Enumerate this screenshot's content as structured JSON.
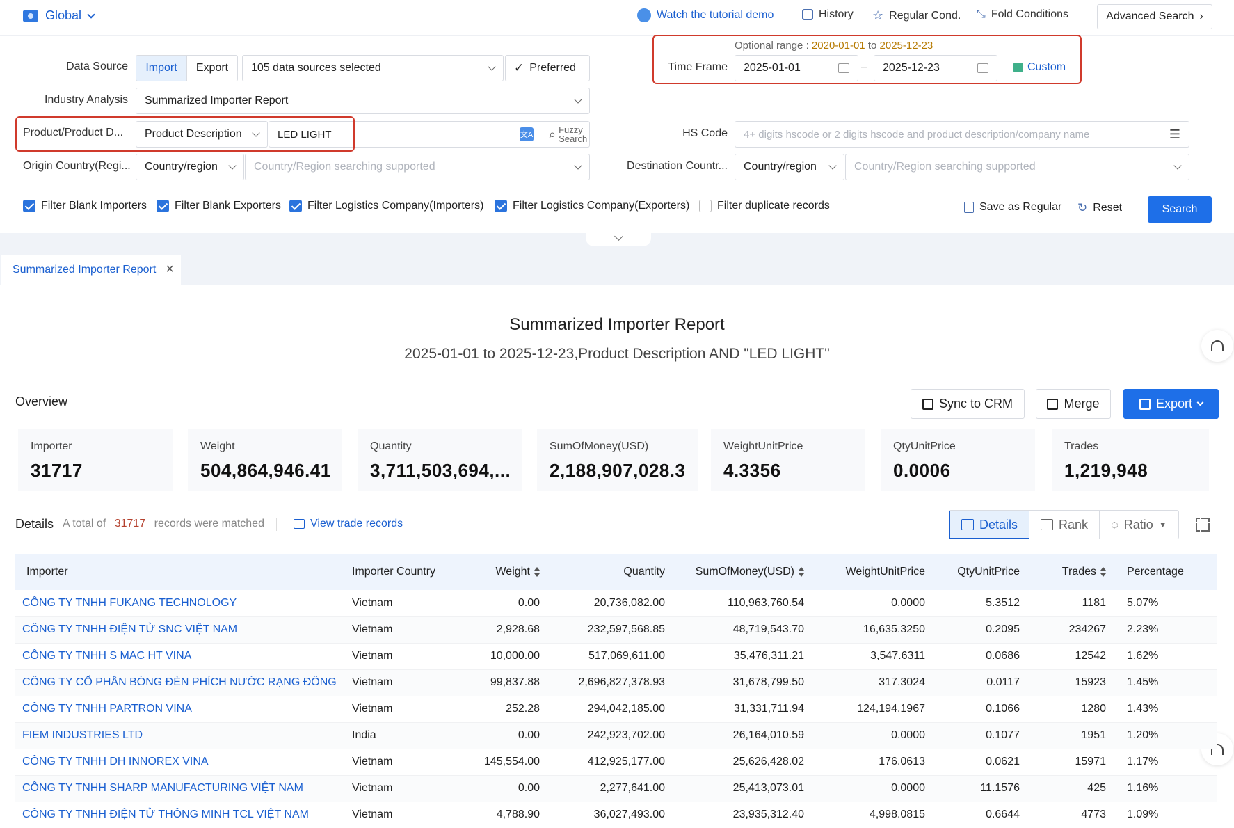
{
  "topbar": {
    "global_label": "Global",
    "tutorial": "Watch the tutorial demo",
    "history": "History",
    "regular_cond": "Regular Cond.",
    "fold_conditions": "Fold Conditions",
    "advanced_search": "Advanced Search"
  },
  "filters": {
    "data_source_label": "Data Source",
    "import_label": "Import",
    "export_label": "Export",
    "sources_selected": "105 data sources selected",
    "preferred": "Preferred",
    "industry_label": "Industry Analysis",
    "industry_value": "Summarized Importer Report",
    "product_label": "Product/Product D...",
    "product_type": "Product Description",
    "product_value": "LED LIGHT",
    "fuzzy_search": "Fuzzy Search",
    "origin_label": "Origin Country(Regi...",
    "origin_type": "Country/region",
    "origin_placeholder": "Country/Region searching supported",
    "optional_range_label": "Optional range :",
    "optional_range_start": "2020-01-01",
    "optional_range_to": "to",
    "optional_range_end": "2025-12-23",
    "timeframe_label": "Time Frame",
    "start_date": "2025-01-01",
    "end_date": "2025-12-23",
    "custom": "Custom",
    "hs_label": "HS Code",
    "hs_placeholder": "4+ digits hscode or 2 digits hscode and product description/company name",
    "dest_label": "Destination Countr...",
    "dest_type": "Country/region",
    "dest_placeholder": "Country/Region searching supported"
  },
  "checks": [
    {
      "label": "Filter Blank Importers",
      "checked": true
    },
    {
      "label": "Filter Blank Exporters",
      "checked": true
    },
    {
      "label": "Filter Logistics Company(Importers)",
      "checked": true
    },
    {
      "label": "Filter Logistics Company(Exporters)",
      "checked": true
    },
    {
      "label": "Filter duplicate records",
      "checked": false
    }
  ],
  "actions": {
    "save_regular": "Save as Regular",
    "reset": "Reset",
    "search": "Search"
  },
  "tab": {
    "label": "Summarized Importer Report"
  },
  "report": {
    "title": "Summarized Importer Report",
    "subtitle": "2025-01-01 to 2025-12-23,Product Description AND \"LED LIGHT\""
  },
  "overview": {
    "title": "Overview",
    "sync": "Sync to CRM",
    "merge": "Merge",
    "export": "Export",
    "stats": [
      {
        "label": "Importer",
        "value": "31717"
      },
      {
        "label": "Weight",
        "value": "504,864,946.41"
      },
      {
        "label": "Quantity",
        "value": "3,711,503,694,..."
      },
      {
        "label": "SumOfMoney(USD)",
        "value": "2,188,907,028.3"
      },
      {
        "label": "WeightUnitPrice",
        "value": "4.3356"
      },
      {
        "label": "QtyUnitPrice",
        "value": "0.0006"
      },
      {
        "label": "Trades",
        "value": "1,219,948"
      }
    ]
  },
  "details": {
    "title": "Details",
    "total_prefix": "A total of",
    "total_count": "31717",
    "total_suffix": "records were matched",
    "view_trade": "View trade records",
    "view_details": "Details",
    "view_rank": "Rank",
    "view_ratio": "Ratio"
  },
  "table": {
    "headers": [
      "Importer",
      "Importer Country",
      "Weight",
      "Quantity",
      "SumOfMoney(USD)",
      "WeightUnitPrice",
      "QtyUnitPrice",
      "Trades",
      "Percentage"
    ],
    "rows": [
      [
        "CÔNG TY TNHH FUKANG TECHNOLOGY",
        "Vietnam",
        "0.00",
        "20,736,082.00",
        "110,963,760.54",
        "0.0000",
        "5.3512",
        "1181",
        "5.07%"
      ],
      [
        "CÔNG TY TNHH ĐIỆN TỬ SNC VIỆT NAM",
        "Vietnam",
        "2,928.68",
        "232,597,568.85",
        "48,719,543.70",
        "16,635.3250",
        "0.2095",
        "234267",
        "2.23%"
      ],
      [
        "CÔNG TY TNHH S MAC HT VINA",
        "Vietnam",
        "10,000.00",
        "517,069,611.00",
        "35,476,311.21",
        "3,547.6311",
        "0.0686",
        "12542",
        "1.62%"
      ],
      [
        "CÔNG TY CỔ PHẦN BÓNG ĐÈN PHÍCH NƯỚC RẠNG ĐÔNG",
        "Vietnam",
        "99,837.88",
        "2,696,827,378.93",
        "31,678,799.50",
        "317.3024",
        "0.0117",
        "15923",
        "1.45%"
      ],
      [
        "CÔNG TY TNHH PARTRON VINA",
        "Vietnam",
        "252.28",
        "294,042,185.00",
        "31,331,711.94",
        "124,194.1967",
        "0.1066",
        "1280",
        "1.43%"
      ],
      [
        "FIEM INDUSTRIES LTD",
        "India",
        "0.00",
        "242,923,702.00",
        "26,164,010.59",
        "0.0000",
        "0.1077",
        "1951",
        "1.20%"
      ],
      [
        "CÔNG TY TNHH DH INNOREX VINA",
        "Vietnam",
        "145,554.00",
        "412,925,177.00",
        "25,626,428.02",
        "176.0613",
        "0.0621",
        "15971",
        "1.17%"
      ],
      [
        "CÔNG TY TNHH SHARP MANUFACTURING VIỆT NAM",
        "Vietnam",
        "0.00",
        "2,277,641.00",
        "25,413,073.01",
        "0.0000",
        "11.1576",
        "425",
        "1.16%"
      ],
      [
        "CÔNG TY TNHH ĐIỆN TỬ THÔNG MINH TCL VIỆT NAM",
        "Vietnam",
        "4,788.90",
        "36,027,493.00",
        "23,935,312.40",
        "4,998.0815",
        "0.6644",
        "4773",
        "1.09%"
      ]
    ]
  }
}
